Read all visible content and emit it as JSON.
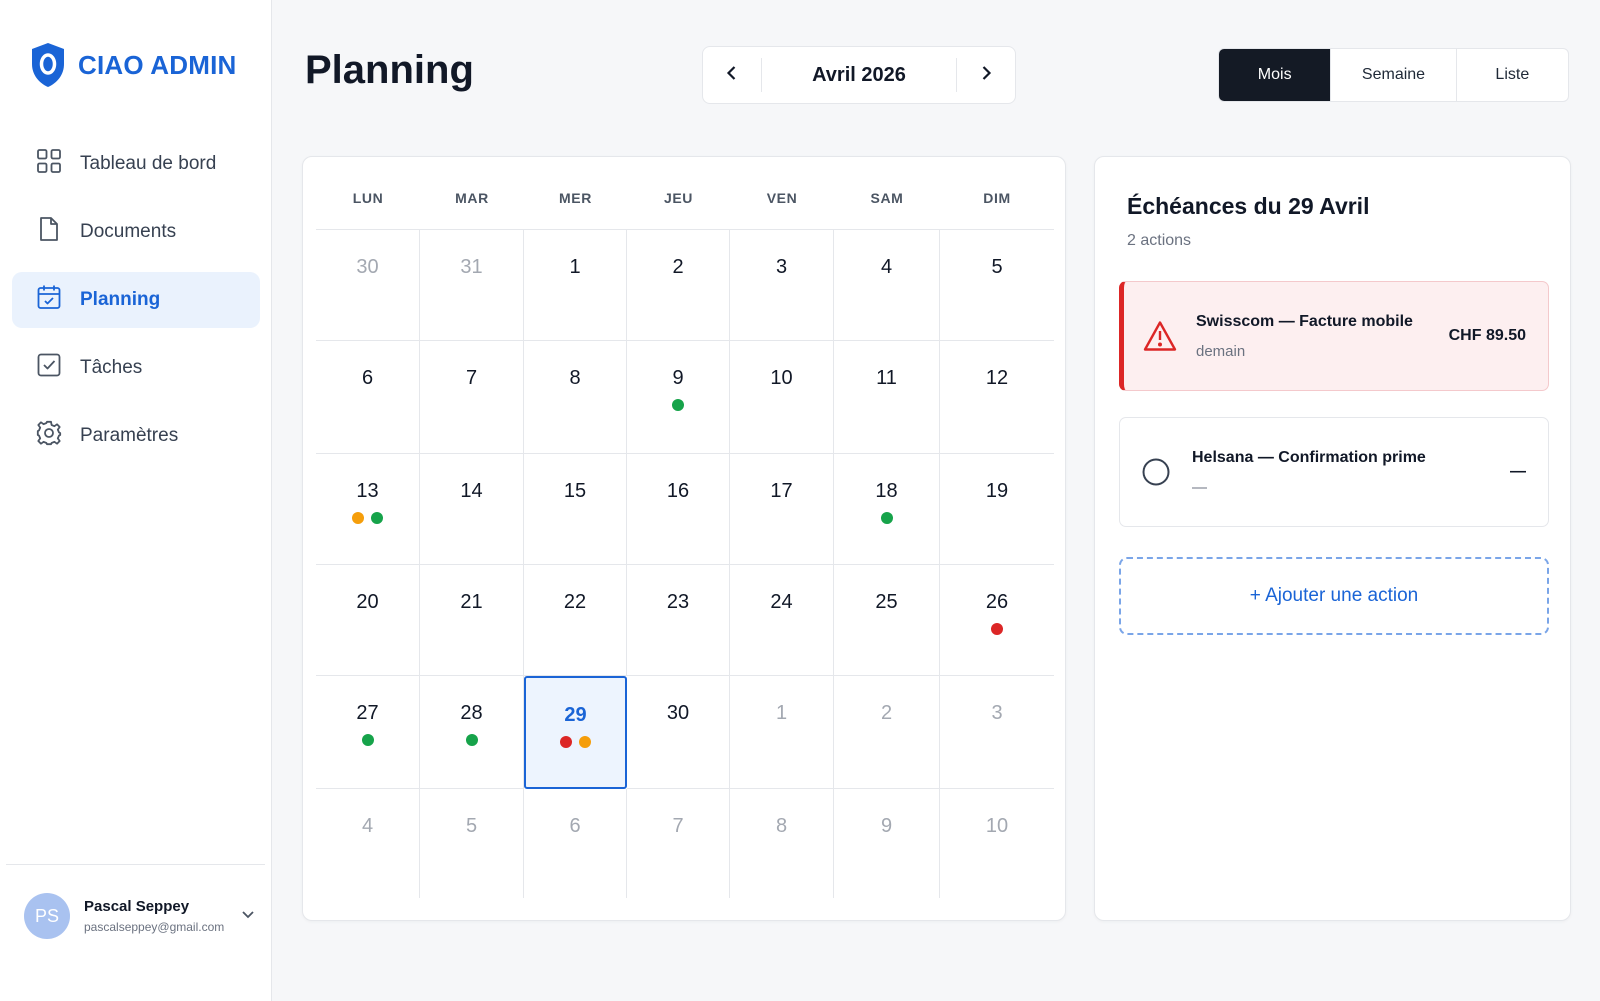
{
  "brand": {
    "name": "CIAO ADMIN",
    "icon": "shield-icon",
    "color": "#1a64d6"
  },
  "sidebar": {
    "items": [
      {
        "label": "Tableau de bord",
        "icon": "grid-icon"
      },
      {
        "label": "Documents",
        "icon": "document-icon"
      },
      {
        "label": "Planning",
        "icon": "calendar-icon",
        "active": true
      },
      {
        "label": "Tâches",
        "icon": "checkbox-icon"
      },
      {
        "label": "Paramètres",
        "icon": "gear-icon"
      }
    ]
  },
  "user": {
    "initials": "PS",
    "name": "Pascal Seppey",
    "email": "pascalseppey@gmail.com"
  },
  "header": {
    "title": "Planning",
    "month_label": "Avril 2026",
    "views": [
      {
        "label": "Mois",
        "active": true
      },
      {
        "label": "Semaine"
      },
      {
        "label": "Liste"
      }
    ]
  },
  "calendar": {
    "weekdays": [
      "LUN",
      "MAR",
      "MER",
      "JEU",
      "VEN",
      "SAM",
      "DIM"
    ],
    "dot_colors": {
      "green": "#16a34a",
      "orange": "#f59e0b",
      "red": "#dc2626"
    },
    "days": [
      {
        "n": "30",
        "muted": true
      },
      {
        "n": "31",
        "muted": true
      },
      {
        "n": "1"
      },
      {
        "n": "2"
      },
      {
        "n": "3"
      },
      {
        "n": "4"
      },
      {
        "n": "5"
      },
      {
        "n": "6"
      },
      {
        "n": "7"
      },
      {
        "n": "8"
      },
      {
        "n": "9",
        "dots": [
          "green"
        ]
      },
      {
        "n": "10"
      },
      {
        "n": "11"
      },
      {
        "n": "12"
      },
      {
        "n": "13",
        "dots": [
          "orange",
          "green"
        ]
      },
      {
        "n": "14"
      },
      {
        "n": "15"
      },
      {
        "n": "16"
      },
      {
        "n": "17"
      },
      {
        "n": "18",
        "dots": [
          "green"
        ]
      },
      {
        "n": "19"
      },
      {
        "n": "20"
      },
      {
        "n": "21"
      },
      {
        "n": "22"
      },
      {
        "n": "23"
      },
      {
        "n": "24"
      },
      {
        "n": "25"
      },
      {
        "n": "26",
        "dots": [
          "red"
        ]
      },
      {
        "n": "27",
        "dots": [
          "green"
        ]
      },
      {
        "n": "28",
        "dots": [
          "green"
        ]
      },
      {
        "n": "29",
        "selected": true,
        "dots": [
          "red",
          "orange"
        ]
      },
      {
        "n": "30"
      },
      {
        "n": "1",
        "muted": true
      },
      {
        "n": "2",
        "muted": true
      },
      {
        "n": "3",
        "muted": true
      },
      {
        "n": "4",
        "muted": true
      },
      {
        "n": "5",
        "muted": true
      },
      {
        "n": "6",
        "muted": true
      },
      {
        "n": "7",
        "muted": true
      },
      {
        "n": "8",
        "muted": true
      },
      {
        "n": "9",
        "muted": true
      },
      {
        "n": "10",
        "muted": true
      }
    ]
  },
  "panel": {
    "title": "Échéances du 29 Avril",
    "subtitle": "2 actions",
    "actions": [
      {
        "title": "Swisscom — Facture mobile",
        "sub": "demain",
        "amount": "CHF 89.50",
        "icon": "warning-icon",
        "urgent": true
      },
      {
        "title": "Helsana — Confirmation prime",
        "sub": "—",
        "amount": "—",
        "icon": "circle-icon"
      }
    ],
    "add_label": "+ Ajouter une action"
  }
}
